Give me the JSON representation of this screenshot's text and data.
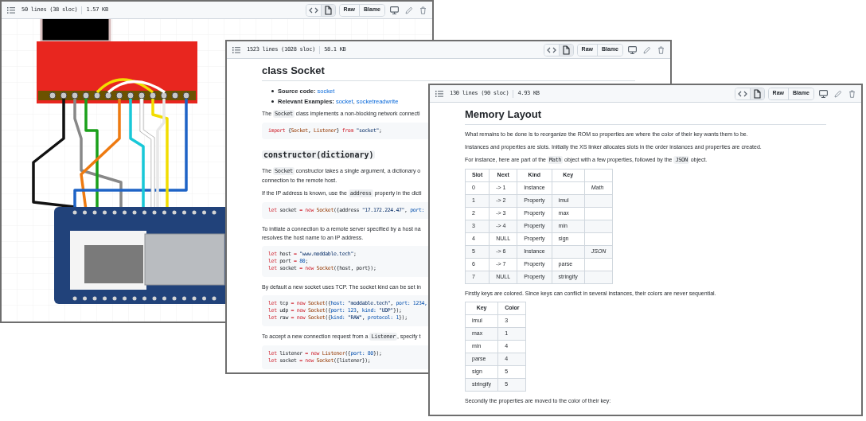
{
  "windows": [
    {
      "header": {
        "lines": "50 lines (38 sloc)",
        "size": "1.57 KB"
      },
      "views": [
        {
          "kind": "code",
          "selected": false
        },
        {
          "kind": "preview",
          "selected": true
        }
      ],
      "buttons": [
        "Raw",
        "Blame"
      ],
      "content": [
        {
          "kind": "diagram"
        }
      ]
    },
    {
      "header": {
        "lines": "1523 lines (1028 sloc)",
        "size": "58.1 KB"
      },
      "views": [
        {
          "kind": "code",
          "selected": false
        },
        {
          "kind": "preview",
          "selected": true
        }
      ],
      "buttons": [
        "Raw",
        "Blame"
      ],
      "content": [
        {
          "kind": "heading",
          "text": "class Socket"
        },
        {
          "kind": "list",
          "items": [
            [
              {
                "kind": "bold",
                "text": "Source code: "
              },
              {
                "kind": "link",
                "text": "socket"
              }
            ],
            [
              {
                "kind": "bold",
                "text": "Relevant Examples: "
              },
              {
                "kind": "link",
                "text": "socket"
              },
              {
                "kind": "text",
                "text": ", "
              },
              {
                "kind": "link",
                "text": "socketreadwrite"
              }
            ]
          ]
        },
        {
          "kind": "paragraph",
          "lines": [
            [
              {
                "kind": "text",
                "text": "The "
              },
              {
                "kind": "code",
                "text": "Socket"
              },
              {
                "kind": "text",
                "text": " class implements a non-blocking network connecti"
              }
            ]
          ]
        },
        {
          "kind": "code",
          "lines": [
            [
              {
                "text": "import",
                "kind": "keyword"
              },
              {
                "text": " {",
                "kind": "plain"
              },
              {
                "text": "Socket",
                "kind": "class"
              },
              {
                "text": ", ",
                "kind": "plain"
              },
              {
                "text": "Listener",
                "kind": "class"
              },
              {
                "text": "} ",
                "kind": "plain"
              },
              {
                "text": "from",
                "kind": "keyword"
              },
              {
                "text": " \"socket\"",
                "kind": "string"
              },
              {
                "text": ";",
                "kind": "plain"
              }
            ]
          ]
        },
        {
          "kind": "code_heading",
          "text": "constructor(dictionary)"
        },
        {
          "kind": "paragraph",
          "lines": [
            [
              {
                "kind": "text",
                "text": "The "
              },
              {
                "kind": "code",
                "text": "Socket"
              },
              {
                "kind": "text",
                "text": " constructor takes a single argument, a dictionary o"
              }
            ],
            [
              {
                "kind": "text",
                "text": "connection to the remote host."
              }
            ]
          ]
        },
        {
          "kind": "paragraph",
          "lines": [
            [
              {
                "kind": "text",
                "text": "If the IP address is known, use the "
              },
              {
                "kind": "code",
                "text": "address"
              },
              {
                "kind": "text",
                "text": " property in the dicti"
              }
            ]
          ]
        },
        {
          "kind": "code",
          "lines": [
            [
              {
                "text": "let",
                "kind": "keyword"
              },
              {
                "text": " socket ",
                "kind": "plain"
              },
              {
                "text": "= new",
                "kind": "keyword"
              },
              {
                "text": " Socket",
                "kind": "class"
              },
              {
                "text": "({address ",
                "kind": "plain"
              },
              {
                "text": "\"17.172.224.47\"",
                "kind": "string"
              },
              {
                "text": ", ",
                "kind": "plain"
              },
              {
                "text": "port:",
                "kind": "property"
              }
            ]
          ]
        },
        {
          "kind": "paragraph",
          "lines": [
            [
              {
                "kind": "text",
                "text": "To initiate a connection to a remote server specified by a host na"
              }
            ],
            [
              {
                "kind": "text",
                "text": "resolves the host name to an IP address."
              }
            ]
          ]
        },
        {
          "kind": "code",
          "lines": [
            [
              {
                "text": "let",
                "kind": "keyword"
              },
              {
                "text": " host ",
                "kind": "plain"
              },
              {
                "text": "=",
                "kind": "keyword"
              },
              {
                "text": " \"www.moddable.tech\"",
                "kind": "string"
              },
              {
                "text": ";",
                "kind": "plain"
              }
            ],
            [
              {
                "text": "let",
                "kind": "keyword"
              },
              {
                "text": " port ",
                "kind": "plain"
              },
              {
                "text": "=",
                "kind": "keyword"
              },
              {
                "text": " 80",
                "kind": "number"
              },
              {
                "text": ";",
                "kind": "plain"
              }
            ],
            [
              {
                "text": "let",
                "kind": "keyword"
              },
              {
                "text": " socket ",
                "kind": "plain"
              },
              {
                "text": "= new",
                "kind": "keyword"
              },
              {
                "text": " Socket",
                "kind": "class"
              },
              {
                "text": "({host, port});",
                "kind": "plain"
              }
            ]
          ]
        },
        {
          "kind": "paragraph",
          "lines": [
            [
              {
                "kind": "text",
                "text": "By default a new socket uses TCP. The socket kind can be set in"
              }
            ]
          ]
        },
        {
          "kind": "code",
          "lines": [
            [
              {
                "text": "let",
                "kind": "keyword"
              },
              {
                "text": " tcp ",
                "kind": "plain"
              },
              {
                "text": "= new",
                "kind": "keyword"
              },
              {
                "text": " Socket",
                "kind": "class"
              },
              {
                "text": "({",
                "kind": "plain"
              },
              {
                "text": "host:",
                "kind": "property"
              },
              {
                "text": " \"moddable.tech\"",
                "kind": "string"
              },
              {
                "text": ", ",
                "kind": "plain"
              },
              {
                "text": "port:",
                "kind": "property"
              },
              {
                "text": " 1234,",
                "kind": "number"
              }
            ],
            [
              {
                "text": "let",
                "kind": "keyword"
              },
              {
                "text": " udp ",
                "kind": "plain"
              },
              {
                "text": "= new",
                "kind": "keyword"
              },
              {
                "text": " Socket",
                "kind": "class"
              },
              {
                "text": "({",
                "kind": "plain"
              },
              {
                "text": "port:",
                "kind": "property"
              },
              {
                "text": " 123",
                "kind": "number"
              },
              {
                "text": ", ",
                "kind": "plain"
              },
              {
                "text": "kind:",
                "kind": "property"
              },
              {
                "text": " \"UDP\"",
                "kind": "string"
              },
              {
                "text": "});",
                "kind": "plain"
              }
            ],
            [
              {
                "text": "let",
                "kind": "keyword"
              },
              {
                "text": " raw ",
                "kind": "plain"
              },
              {
                "text": "= new",
                "kind": "keyword"
              },
              {
                "text": " Socket",
                "kind": "class"
              },
              {
                "text": "({",
                "kind": "plain"
              },
              {
                "text": "kind:",
                "kind": "property"
              },
              {
                "text": " \"RAW\"",
                "kind": "string"
              },
              {
                "text": ", ",
                "kind": "plain"
              },
              {
                "text": "protocol:",
                "kind": "property"
              },
              {
                "text": " 1",
                "kind": "number"
              },
              {
                "text": "});",
                "kind": "plain"
              }
            ]
          ]
        },
        {
          "kind": "paragraph",
          "lines": [
            [
              {
                "kind": "text",
                "text": "To accept a new connection request from a "
              },
              {
                "kind": "code",
                "text": "Listener"
              },
              {
                "kind": "text",
                "text": ", specify t"
              }
            ]
          ]
        },
        {
          "kind": "code",
          "lines": [
            [
              {
                "text": "let",
                "kind": "keyword"
              },
              {
                "text": " listener ",
                "kind": "plain"
              },
              {
                "text": "= new",
                "kind": "keyword"
              },
              {
                "text": " Listener",
                "kind": "class"
              },
              {
                "text": "({",
                "kind": "plain"
              },
              {
                "text": "port:",
                "kind": "property"
              },
              {
                "text": " 80",
                "kind": "number"
              },
              {
                "text": "});",
                "kind": "plain"
              }
            ],
            [
              {
                "text": "let",
                "kind": "keyword"
              },
              {
                "text": " socket ",
                "kind": "plain"
              },
              {
                "text": "= new",
                "kind": "keyword"
              },
              {
                "text": " Socket",
                "kind": "class"
              },
              {
                "text": "({listener});",
                "kind": "plain"
              }
            ]
          ]
        }
      ]
    },
    {
      "header": {
        "lines": "130 lines (90 sloc)",
        "size": "4.93 KB"
      },
      "views": [
        {
          "kind": "code",
          "selected": false
        },
        {
          "kind": "preview",
          "selected": true
        }
      ],
      "buttons": [
        "Raw",
        "Blame"
      ],
      "content": [
        {
          "kind": "heading",
          "text": "Memory Layout"
        },
        {
          "kind": "paragraph",
          "lines": [
            [
              {
                "kind": "text",
                "text": "What remains to be done is to reorganize the ROM so properties are where the color of their key wants them to be."
              }
            ]
          ]
        },
        {
          "kind": "paragraph",
          "lines": [
            [
              {
                "kind": "text",
                "text": "Instances and properties are slots. Initially the XS linker allocates slots in the order instances and properties are created."
              }
            ]
          ]
        },
        {
          "kind": "paragraph",
          "lines": [
            [
              {
                "kind": "text",
                "text": "For instance, here are part of the "
              },
              {
                "kind": "code",
                "text": "Math"
              },
              {
                "kind": "text",
                "text": " object with a few properties, followed by the "
              },
              {
                "kind": "code",
                "text": "JSON"
              },
              {
                "kind": "text",
                "text": " object."
              }
            ]
          ]
        },
        {
          "kind": "table",
          "columns": [
            "Slot",
            "Next",
            "Kind",
            "Key"
          ],
          "rows": [
            {
              "slot": "0",
              "next": "-> 1",
              "kind": "Instance",
              "column_5": "Math"
            },
            {
              "slot": "1",
              "next": "-> 2",
              "kind": "Property",
              "key": "imul"
            },
            {
              "slot": "2",
              "next": "-> 3",
              "kind": "Property",
              "key": "max"
            },
            {
              "slot": "3",
              "next": "-> 4",
              "kind": "Property",
              "key": "min"
            },
            {
              "slot": "4",
              "next": "NULL",
              "kind": "Property",
              "key": "sign"
            },
            {
              "slot": "5",
              "next": "-> 6",
              "kind": "Instance",
              "column_5": "JSON"
            },
            {
              "slot": "6",
              "next": "-> 7",
              "kind": "Property",
              "key": "parse"
            },
            {
              "slot": "7",
              "next": "NULL",
              "kind": "Property",
              "key": "stringify"
            }
          ]
        },
        {
          "kind": "paragraph",
          "lines": [
            [
              {
                "kind": "text",
                "text": "Firstly keys are colored. Since keys can conflict in several instances, their colors are never sequential."
              }
            ]
          ]
        },
        {
          "kind": "table",
          "columns": [
            "Key",
            "Color"
          ],
          "rows": [
            {
              "key": "imul",
              "color_number": "3"
            },
            {
              "key": "max",
              "color_number": "1"
            },
            {
              "key": "min",
              "color_number": "4"
            },
            {
              "key": "parse",
              "color_number": "4"
            },
            {
              "key": "sign",
              "color_number": "5"
            },
            {
              "key": "stringify",
              "color_number": "5"
            }
          ]
        },
        {
          "kind": "paragraph",
          "lines": [
            [
              {
                "kind": "text",
                "text": "Secondly the properties are moved to the color of their key:"
              }
            ]
          ]
        }
      ]
    }
  ]
}
